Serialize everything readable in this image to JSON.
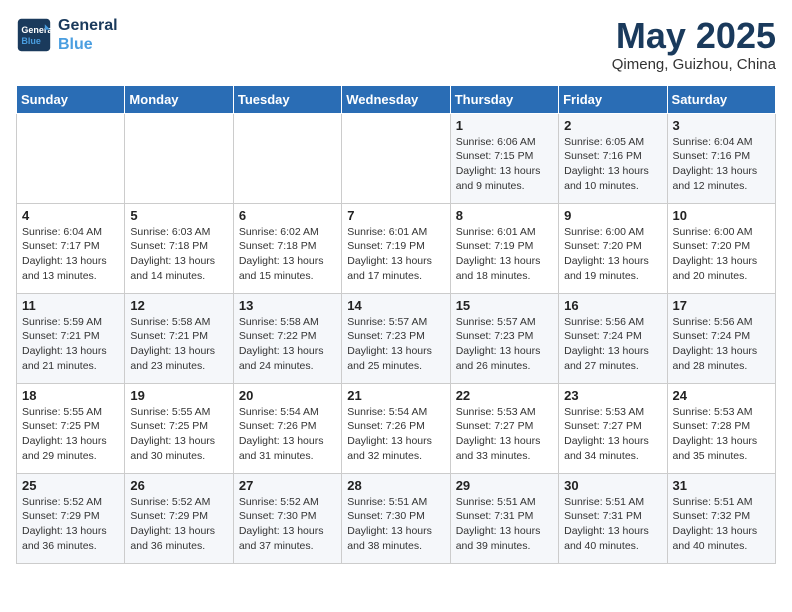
{
  "header": {
    "logo_line1": "General",
    "logo_line2": "Blue",
    "month": "May 2025",
    "location": "Qimeng, Guizhou, China"
  },
  "weekdays": [
    "Sunday",
    "Monday",
    "Tuesday",
    "Wednesday",
    "Thursday",
    "Friday",
    "Saturday"
  ],
  "weeks": [
    [
      {
        "day": "",
        "info": ""
      },
      {
        "day": "",
        "info": ""
      },
      {
        "day": "",
        "info": ""
      },
      {
        "day": "",
        "info": ""
      },
      {
        "day": "1",
        "info": "Sunrise: 6:06 AM\nSunset: 7:15 PM\nDaylight: 13 hours\nand 9 minutes."
      },
      {
        "day": "2",
        "info": "Sunrise: 6:05 AM\nSunset: 7:16 PM\nDaylight: 13 hours\nand 10 minutes."
      },
      {
        "day": "3",
        "info": "Sunrise: 6:04 AM\nSunset: 7:16 PM\nDaylight: 13 hours\nand 12 minutes."
      }
    ],
    [
      {
        "day": "4",
        "info": "Sunrise: 6:04 AM\nSunset: 7:17 PM\nDaylight: 13 hours\nand 13 minutes."
      },
      {
        "day": "5",
        "info": "Sunrise: 6:03 AM\nSunset: 7:18 PM\nDaylight: 13 hours\nand 14 minutes."
      },
      {
        "day": "6",
        "info": "Sunrise: 6:02 AM\nSunset: 7:18 PM\nDaylight: 13 hours\nand 15 minutes."
      },
      {
        "day": "7",
        "info": "Sunrise: 6:01 AM\nSunset: 7:19 PM\nDaylight: 13 hours\nand 17 minutes."
      },
      {
        "day": "8",
        "info": "Sunrise: 6:01 AM\nSunset: 7:19 PM\nDaylight: 13 hours\nand 18 minutes."
      },
      {
        "day": "9",
        "info": "Sunrise: 6:00 AM\nSunset: 7:20 PM\nDaylight: 13 hours\nand 19 minutes."
      },
      {
        "day": "10",
        "info": "Sunrise: 6:00 AM\nSunset: 7:20 PM\nDaylight: 13 hours\nand 20 minutes."
      }
    ],
    [
      {
        "day": "11",
        "info": "Sunrise: 5:59 AM\nSunset: 7:21 PM\nDaylight: 13 hours\nand 21 minutes."
      },
      {
        "day": "12",
        "info": "Sunrise: 5:58 AM\nSunset: 7:21 PM\nDaylight: 13 hours\nand 23 minutes."
      },
      {
        "day": "13",
        "info": "Sunrise: 5:58 AM\nSunset: 7:22 PM\nDaylight: 13 hours\nand 24 minutes."
      },
      {
        "day": "14",
        "info": "Sunrise: 5:57 AM\nSunset: 7:23 PM\nDaylight: 13 hours\nand 25 minutes."
      },
      {
        "day": "15",
        "info": "Sunrise: 5:57 AM\nSunset: 7:23 PM\nDaylight: 13 hours\nand 26 minutes."
      },
      {
        "day": "16",
        "info": "Sunrise: 5:56 AM\nSunset: 7:24 PM\nDaylight: 13 hours\nand 27 minutes."
      },
      {
        "day": "17",
        "info": "Sunrise: 5:56 AM\nSunset: 7:24 PM\nDaylight: 13 hours\nand 28 minutes."
      }
    ],
    [
      {
        "day": "18",
        "info": "Sunrise: 5:55 AM\nSunset: 7:25 PM\nDaylight: 13 hours\nand 29 minutes."
      },
      {
        "day": "19",
        "info": "Sunrise: 5:55 AM\nSunset: 7:25 PM\nDaylight: 13 hours\nand 30 minutes."
      },
      {
        "day": "20",
        "info": "Sunrise: 5:54 AM\nSunset: 7:26 PM\nDaylight: 13 hours\nand 31 minutes."
      },
      {
        "day": "21",
        "info": "Sunrise: 5:54 AM\nSunset: 7:26 PM\nDaylight: 13 hours\nand 32 minutes."
      },
      {
        "day": "22",
        "info": "Sunrise: 5:53 AM\nSunset: 7:27 PM\nDaylight: 13 hours\nand 33 minutes."
      },
      {
        "day": "23",
        "info": "Sunrise: 5:53 AM\nSunset: 7:27 PM\nDaylight: 13 hours\nand 34 minutes."
      },
      {
        "day": "24",
        "info": "Sunrise: 5:53 AM\nSunset: 7:28 PM\nDaylight: 13 hours\nand 35 minutes."
      }
    ],
    [
      {
        "day": "25",
        "info": "Sunrise: 5:52 AM\nSunset: 7:29 PM\nDaylight: 13 hours\nand 36 minutes."
      },
      {
        "day": "26",
        "info": "Sunrise: 5:52 AM\nSunset: 7:29 PM\nDaylight: 13 hours\nand 36 minutes."
      },
      {
        "day": "27",
        "info": "Sunrise: 5:52 AM\nSunset: 7:30 PM\nDaylight: 13 hours\nand 37 minutes."
      },
      {
        "day": "28",
        "info": "Sunrise: 5:51 AM\nSunset: 7:30 PM\nDaylight: 13 hours\nand 38 minutes."
      },
      {
        "day": "29",
        "info": "Sunrise: 5:51 AM\nSunset: 7:31 PM\nDaylight: 13 hours\nand 39 minutes."
      },
      {
        "day": "30",
        "info": "Sunrise: 5:51 AM\nSunset: 7:31 PM\nDaylight: 13 hours\nand 40 minutes."
      },
      {
        "day": "31",
        "info": "Sunrise: 5:51 AM\nSunset: 7:32 PM\nDaylight: 13 hours\nand 40 minutes."
      }
    ]
  ]
}
